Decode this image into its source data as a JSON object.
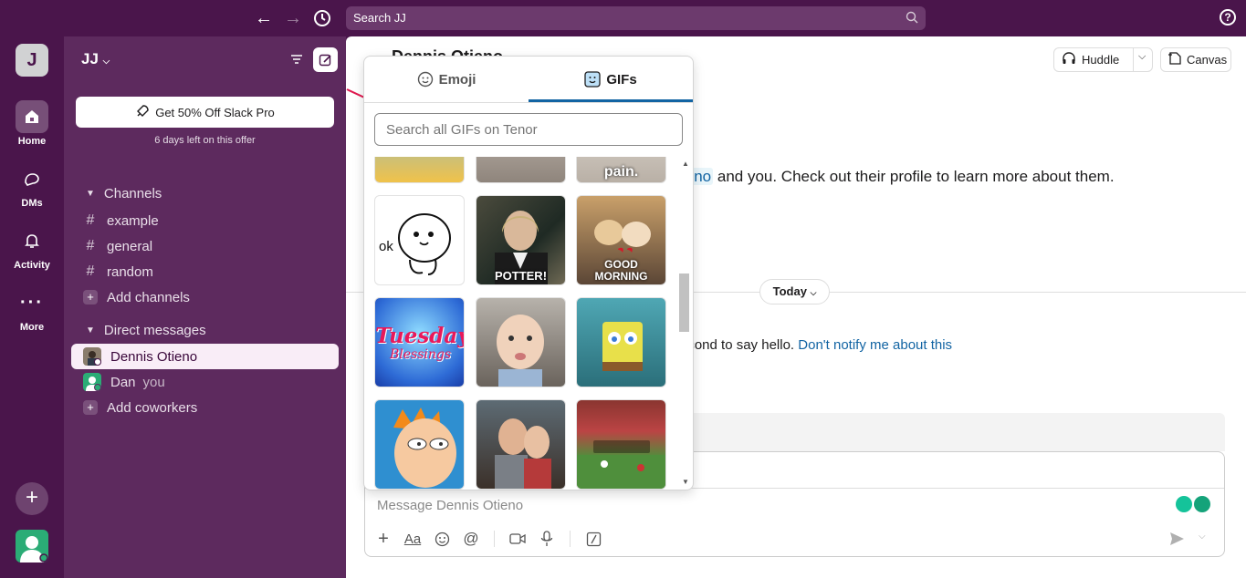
{
  "topbar": {
    "search_label": "Search JJ",
    "help_label": "?"
  },
  "rail": {
    "workspace_initial": "J",
    "items": [
      {
        "label": "Home"
      },
      {
        "label": "DMs"
      },
      {
        "label": "Activity"
      },
      {
        "label": "More"
      }
    ]
  },
  "sidebar": {
    "workspace_name": "JJ",
    "promo_button": "Get 50% Off Slack Pro",
    "promo_sub": "6 days left on this offer",
    "channels_header": "Channels",
    "channels": [
      "example",
      "general",
      "random"
    ],
    "add_channels": "Add channels",
    "dm_header": "Direct messages",
    "dms": [
      {
        "name": "Dennis Otieno",
        "suffix": ""
      },
      {
        "name": "Dan",
        "suffix": "you"
      }
    ],
    "add_coworkers": "Add coworkers"
  },
  "main": {
    "channel_title": "Dennis Otieno",
    "huddle_label": "Huddle",
    "canvas_label": "Canvas",
    "intro_mention": "ieno",
    "intro_rest": " and you. Check out their profile to learn more about them.",
    "today_label": "Today",
    "hello_text": "econd to say hello. ",
    "hello_link": "Don't notify me about this",
    "composer_placeholder": "Message Dennis Otieno"
  },
  "picker": {
    "tab_emoji": "Emoji",
    "tab_gifs": "GIFs",
    "search_placeholder": "Search all GIFs on Tenor",
    "gif_captions": {
      "top_right_partial": "pain.",
      "potter": "POTTER!",
      "good_morning": "GOOD MORNING",
      "tuesday_line1": "Tuesday",
      "tuesday_line2": "Blessings",
      "ok_text": "ok"
    }
  },
  "colors": {
    "aubergine": "#4a154b",
    "sidebar": "#5d2a5e",
    "link": "#1264a3",
    "annotation": "#e0194f"
  }
}
